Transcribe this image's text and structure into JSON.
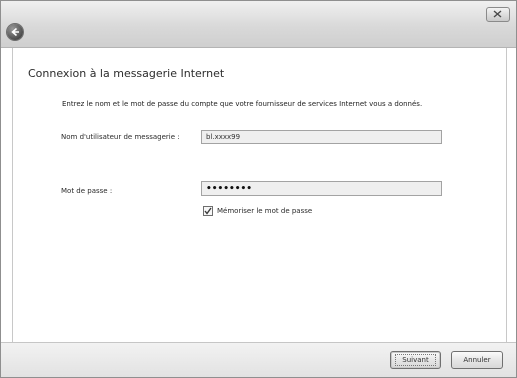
{
  "dialog": {
    "title": "Connexion à la messagerie Internet",
    "instructions": "Entrez le nom et le mot de passe du compte que votre fournisseur de services Internet vous a donnés.",
    "username": {
      "label": "Nom d'utilisateur de messagerie :",
      "value": "bl.xxxx99"
    },
    "password": {
      "label": "Mot de passe :",
      "value": "••••••••"
    },
    "remember": {
      "label": "Mémoriser le mot de passe",
      "checked": true
    },
    "buttons": {
      "next": "Suivant",
      "cancel": "Annuler"
    }
  },
  "icons": {
    "back": "back-arrow-icon",
    "close": "close-icon",
    "check": "checkmark-icon"
  },
  "colors": {
    "titlebar": "#d9d9d9",
    "footer": "#e6e6e6",
    "field_bg": "#efefef"
  }
}
